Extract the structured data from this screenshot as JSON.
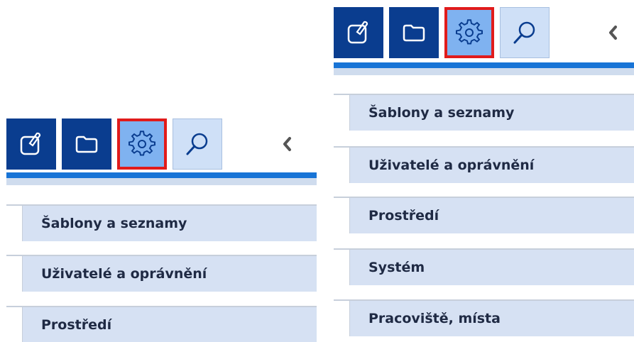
{
  "panels": [
    {
      "toolbar": {
        "buttons": [
          {
            "icon": "edit-document-icon"
          },
          {
            "icon": "folder-icon"
          },
          {
            "icon": "gear-icon",
            "active": true
          },
          {
            "icon": "search-icon"
          }
        ],
        "collapse_icon": "chevron-left-icon"
      },
      "menu_items": [
        "Šablony a seznamy",
        "Uživatelé a oprávnění",
        "Prostředí"
      ]
    },
    {
      "toolbar": {
        "buttons": [
          {
            "icon": "edit-document-icon"
          },
          {
            "icon": "folder-icon"
          },
          {
            "icon": "gear-icon",
            "active": true
          },
          {
            "icon": "search-icon"
          }
        ],
        "collapse_icon": "chevron-left-icon"
      },
      "menu_items": [
        "Šablony a seznamy",
        "Uživatelé a oprávnění",
        "Prostředí",
        "Systém",
        "Pracoviště, místa"
      ]
    }
  ],
  "colors": {
    "toolbar_dark": "#0a3d8f",
    "toolbar_active": "#7fb2f0",
    "toolbar_pale": "#cfe0f7",
    "highlight": "#e11b1b",
    "accent_bar": "#1874d6",
    "menu_bg": "#d6e1f3"
  }
}
